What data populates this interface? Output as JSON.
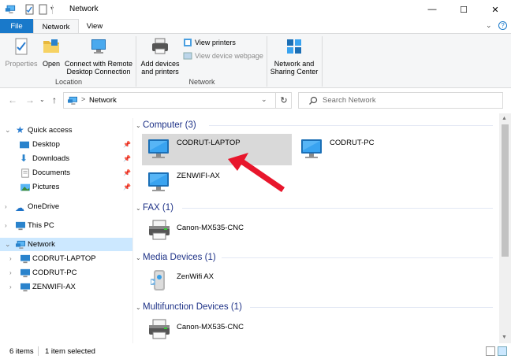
{
  "window": {
    "title": "Network",
    "minimize_glyph": "—",
    "maximize_glyph": "☐",
    "close_glyph": "✕"
  },
  "ribbon_tabs": {
    "file": "File",
    "network": "Network",
    "view": "View"
  },
  "ribbon": {
    "location": {
      "properties": "Properties",
      "open": "Open",
      "connect_line1": "Connect with Remote",
      "connect_line2": "Desktop Connection",
      "group_label": "Location"
    },
    "network": {
      "add_devices_line1": "Add devices",
      "add_devices_line2": "and printers",
      "view_printers": "View printers",
      "view_webpage": "View device webpage",
      "group_label": "Network"
    },
    "sharing": {
      "line1": "Network and",
      "line2": "Sharing Center"
    }
  },
  "address": {
    "path": "Network",
    "separator": ">",
    "search_placeholder": "Search Network"
  },
  "nav_pane": {
    "quick_access": "Quick access",
    "desktop": "Desktop",
    "downloads": "Downloads",
    "documents": "Documents",
    "pictures": "Pictures",
    "onedrive": "OneDrive",
    "this_pc": "This PC",
    "network": "Network",
    "network_children": [
      "CODRUT-LAPTOP",
      "CODRUT-PC",
      "ZENWIFI-AX"
    ]
  },
  "content": {
    "groups": {
      "computer": "Computer (3)",
      "fax": "FAX (1)",
      "media": "Media Devices (1)",
      "multifunction": "Multifunction Devices (1)"
    },
    "computers": [
      "CODRUT-LAPTOP",
      "CODRUT-PC",
      "ZENWIFI-AX"
    ],
    "fax": [
      "Canon-MX535-CNC"
    ],
    "media": [
      "ZenWifi AX"
    ],
    "multifunction": [
      "Canon-MX535-CNC"
    ]
  },
  "status": {
    "items": "6 items",
    "selected": "1 item selected"
  },
  "colors": {
    "accent": "#1979ca",
    "selection": "#cce8ff",
    "group_text": "#1e3287",
    "annotation": "#e8162c"
  }
}
